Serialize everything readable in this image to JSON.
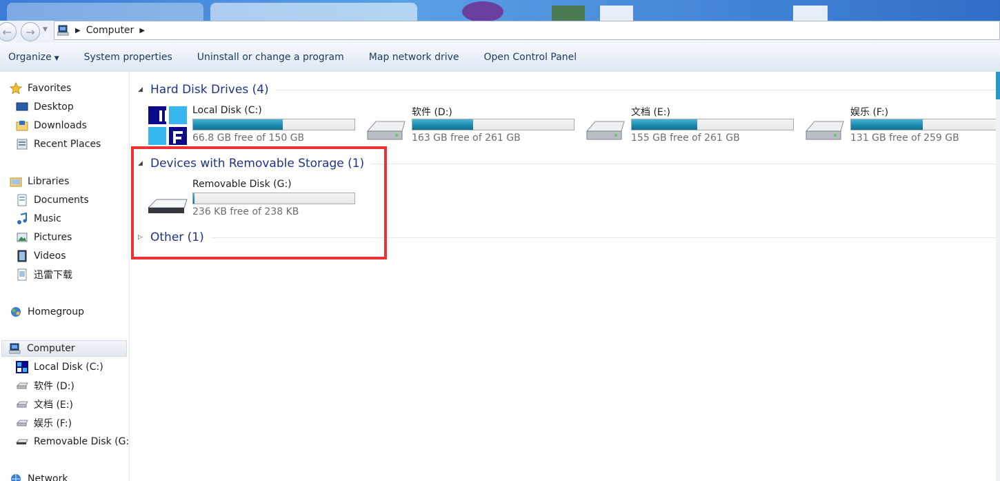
{
  "breadcrumb": {
    "location": "Computer"
  },
  "toolbar": {
    "organize": "Organize",
    "system_properties": "System properties",
    "uninstall": "Uninstall or change a program",
    "map_network": "Map network drive",
    "control_panel": "Open Control Panel"
  },
  "sidebar": {
    "favorites": "Favorites",
    "desktop": "Desktop",
    "downloads": "Downloads",
    "recent": "Recent Places",
    "libraries": "Libraries",
    "documents": "Documents",
    "music": "Music",
    "pictures": "Pictures",
    "videos": "Videos",
    "xunlei": "迅雷下载",
    "homegroup": "Homegroup",
    "computer": "Computer",
    "drive_c": "Local Disk (C:)",
    "drive_d": "软件 (D:)",
    "drive_e": "文档 (E:)",
    "drive_f": "娱乐 (F:)",
    "drive_g": "Removable Disk (G:)",
    "network": "Network"
  },
  "groups": {
    "hdd": "Hard Disk Drives (4)",
    "removable": "Devices with Removable Storage (1)",
    "other": "Other (1)"
  },
  "drives": [
    {
      "name": "Local Disk (C:)",
      "free": "66.8 GB free of 150 GB",
      "used_fraction": 0.555
    },
    {
      "name": "软件 (D:)",
      "free": "163 GB free of 261 GB",
      "used_fraction": 0.375
    },
    {
      "name": "文档 (E:)",
      "free": "155 GB free of 261 GB",
      "used_fraction": 0.406
    },
    {
      "name": "娱乐 (F:)",
      "free": "131 GB free of 259 GB",
      "used_fraction": 0.494
    },
    {
      "name": "Removable Disk (G:)",
      "free": "236 KB free of 238 KB",
      "used_fraction": 0.008
    }
  ],
  "colors": {
    "accent": "#1e3287",
    "bar_fill": "#1e8fb4",
    "highlight": "#ee3134"
  },
  "icons": [
    "back-icon",
    "forward-icon",
    "computer-icon",
    "star-icon",
    "folder-icon",
    "hard-drive-icon",
    "usb-drive-icon",
    "network-icon",
    "homegroup-icon",
    "mfc-icon"
  ]
}
